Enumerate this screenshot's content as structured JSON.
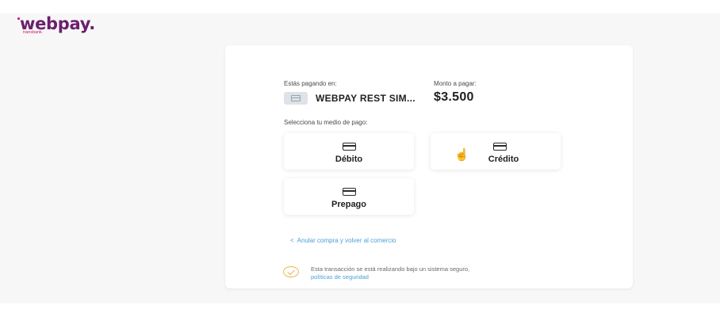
{
  "header": {
    "logo_text": "webpay.",
    "logo_sub": "transbank."
  },
  "payment": {
    "paying_at_label": "Estás pagando en:",
    "merchant_name": "WEBPAY REST SIM...",
    "amount_label": "Monto a pagar:",
    "amount": "$3.500",
    "select_method_label": "Selecciona tu medio de pago:"
  },
  "methods": [
    {
      "label": "Débito",
      "icon": "credit-card-icon"
    },
    {
      "label": "Crédito",
      "icon": "credit-card-icon"
    },
    {
      "label": "Prepago",
      "icon": "credit-card-icon"
    }
  ],
  "cancel": {
    "chevron": "<",
    "label": "Anular compra y volver al comercio"
  },
  "security": {
    "text": "Esta transacción se está realizando bajo un sistema seguro,",
    "link": "políticas de seguridad",
    "icon": "shield-check-icon"
  },
  "colors": {
    "brand": "#6b1f6b",
    "accent": "#d0006f",
    "link": "#4a9fd8",
    "shield": "#e9b44c"
  }
}
